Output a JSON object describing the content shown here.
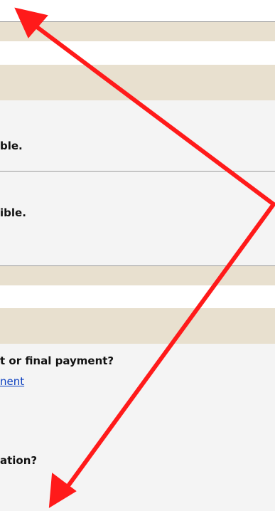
{
  "section_one": {
    "line_a": "ble.",
    "line_b": "ible."
  },
  "section_two": {
    "question_1": "t or final payment?",
    "link_1": "nent",
    "question_2": "ation?"
  },
  "annotation": {
    "type": "red-arrows",
    "color": "#ff1a1a"
  }
}
